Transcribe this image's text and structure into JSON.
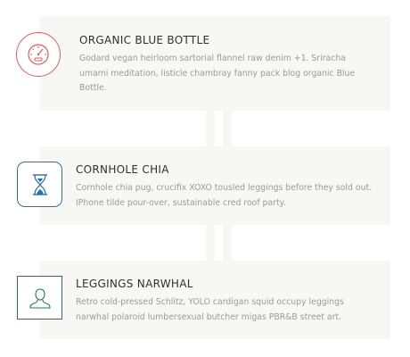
{
  "features": [
    {
      "title": "ORGANIC BLUE BOTTLE",
      "description": "Godard vegan heirloom sartorial flannel raw denim +1. Sriracha umami meditation, listicle chambray fanny pack blog organic Blue Bottle.",
      "icon": "speedometer-icon",
      "icon_color": "#e35d5d",
      "icon_shape": "circle"
    },
    {
      "title": "CORNHOLE CHIA",
      "description": "Cornhole chia pug, crucifix XOXO tousled leggings before they sold out. IPhone tilde pour-over, sustainable cred roof party.",
      "icon": "hourglass-icon",
      "icon_color": "#2a6fb0",
      "icon_shape": "rounded-square"
    },
    {
      "title": "LEGGINGS NARWHAL",
      "description": "Retro cold-pressed Schlitz, YOLO cardigan squid occupy leggings narwhal polaroid lumbersexual butcher migas PBR&B street art.",
      "icon": "user-icon",
      "icon_color": "#1e7a4e",
      "icon_shape": "square"
    }
  ]
}
